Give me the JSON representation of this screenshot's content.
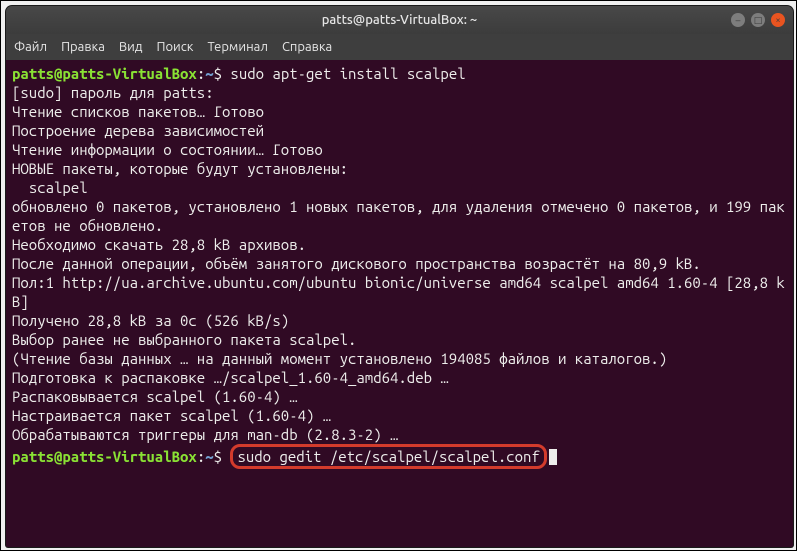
{
  "window": {
    "title": "patts@patts-VirtualBox: ~"
  },
  "menu": {
    "file": "Файл",
    "edit": "Правка",
    "view": "Вид",
    "search": "Поиск",
    "terminal": "Терминал",
    "help": "Справка"
  },
  "prompt": {
    "userhost": "patts@patts-VirtualBox",
    "sep": ":",
    "path": "~",
    "sym": "$"
  },
  "lines": {
    "cmd1": " sudo apt-get install scalpel",
    "l1": "[sudo] пароль для patts:",
    "l2": "Чтение списков пакетов… Готово",
    "l3": "Построение дерева зависимостей",
    "l4": "Чтение информации о состоянии… Готово",
    "l5": "НОВЫЕ пакеты, которые будут установлены:",
    "l6": "  scalpel",
    "l7": "обновлено 0 пакетов, установлено 1 новых пакетов, для удаления отмечено 0 пакетов, и 199 пакетов не обновлено.",
    "l8": "Необходимо скачать 28,8 kB архивов.",
    "l9": "После данной операции, объём занятого дискового пространства возрастёт на 80,9 kB.",
    "l10": "Пол:1 http://ua.archive.ubuntu.com/ubuntu bionic/universe amd64 scalpel amd64 1.60-4 [28,8 kB]",
    "l11": "Получено 28,8 kB за 0с (526 kB/s)",
    "l12": "Выбор ранее не выбранного пакета scalpel.",
    "l13": "(Чтение базы данных … на данный момент установлено 194085 файлов и каталогов.)",
    "l14": "Подготовка к распаковке …/scalpel_1.60-4_amd64.deb …",
    "l15": "Распаковывается scalpel (1.60-4) …",
    "l16": "Настраивается пакет scalpel (1.60-4) …",
    "l17": "Обрабатываются триггеры для man-db (2.8.3-2) …",
    "cmd2": "sudo gedit /etc/scalpel/scalpel.conf"
  }
}
